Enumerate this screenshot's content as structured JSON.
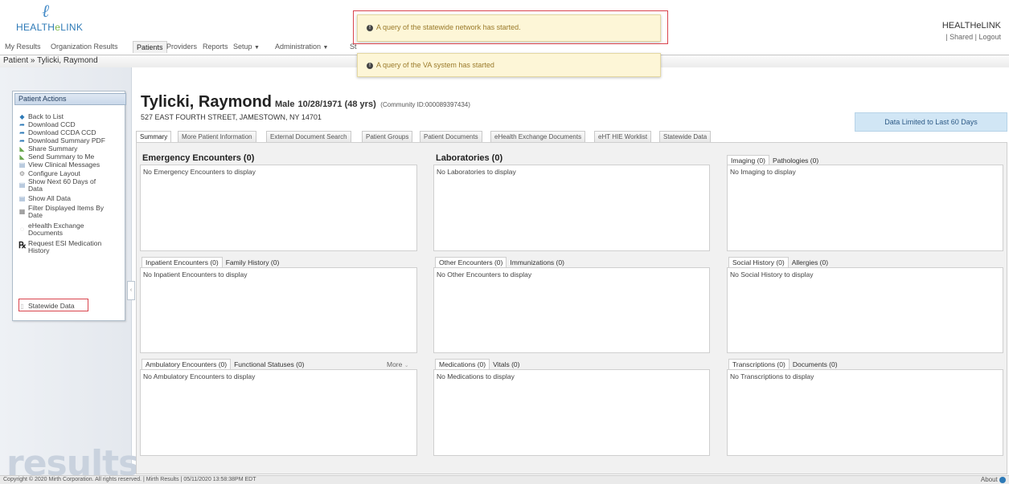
{
  "header": {
    "logo_text_a": "HEALTH",
    "logo_text_e": "e",
    "logo_text_b": "LINK",
    "org_name": "HEALTHeLINK",
    "shared_link": "| Shared",
    "logout_link": "| Logout"
  },
  "nav": {
    "my_results": "My Results",
    "organization_results": "Organization Results",
    "patients": "Patients",
    "providers": "Providers",
    "reports": "Reports",
    "setup": "Setup",
    "administration": "Administration",
    "st": "St"
  },
  "breadcrumb": "Patient » Tylicki, Raymond",
  "toasts": {
    "statewide": "A query of the statewide network has started.",
    "va": "A query of the VA system has started"
  },
  "sidebar": {
    "title": "Patient Actions",
    "items": [
      {
        "label": "Back to List",
        "icon": "diamond-icon"
      },
      {
        "label": "Download CCD",
        "icon": "arrow-icon"
      },
      {
        "label": "Download CCDA CCD",
        "icon": "arrow-icon"
      },
      {
        "label": "Download Summary PDF",
        "icon": "arrow-icon"
      },
      {
        "label": "Share Summary",
        "icon": "share-icon"
      },
      {
        "label": "Send Summary to Me",
        "icon": "send-icon"
      },
      {
        "label": "View Clinical Messages",
        "icon": "document-icon"
      },
      {
        "label": "Configure Layout",
        "icon": "gear-icon"
      },
      {
        "label": "Show Next 60 Days of Data",
        "icon": "document-icon"
      },
      {
        "label": "Show All Data",
        "icon": "document-icon"
      },
      {
        "label": "Filter Displayed Items By Date",
        "icon": "calendar-icon"
      },
      {
        "label": "eHealth Exchange Documents",
        "icon": "exchange-icon"
      },
      {
        "label": "Request ESI Medication History",
        "icon": "rx-icon"
      },
      {
        "label": "Statewide Data",
        "icon": "page-icon"
      }
    ],
    "watermark": "results"
  },
  "patient": {
    "name": "Tylicki, Raymond",
    "gender": "Male",
    "dob": "10/28/1971 (48 yrs)",
    "community_id": "(Community ID:000089397434)",
    "address": "527 EAST FOURTH STREET, JAMESTOWN, NY 14701"
  },
  "data_limited": "Data Limited to Last 60 Days",
  "tabs": [
    "Summary",
    "More Patient Information",
    "External Document Search",
    "Patient Groups",
    "Patient Documents",
    "eHealth Exchange Documents",
    "eHT HIE Worklist",
    "Statewide Data"
  ],
  "panels": {
    "emergency": {
      "title": "Emergency Encounters (0)",
      "empty": "No Emergency Encounters to display"
    },
    "laboratories": {
      "title": "Laboratories (0)",
      "empty": "No Laboratories to display"
    },
    "imaging": {
      "tab1": "Imaging (0)",
      "tab2": "Pathologies (0)",
      "empty": "No Imaging to display"
    },
    "inpatient": {
      "tab1": "Inpatient Encounters (0)",
      "tab2": "Family History (0)",
      "empty": "No Inpatient Encounters to display"
    },
    "other": {
      "tab1": "Other Encounters (0)",
      "tab2": "Immunizations (0)",
      "empty": "No Other Encounters to display"
    },
    "social": {
      "tab1": "Social History (0)",
      "tab2": "Allergies (0)",
      "empty": "No Social History to display"
    },
    "ambulatory": {
      "tab1": "Ambulatory Encounters (0)",
      "tab2": "Functional Statuses (0)",
      "more": "More",
      "empty": "No Ambulatory Encounters to display"
    },
    "medications": {
      "tab1": "Medications (0)",
      "tab2": "Vitals (0)",
      "empty": "No Medications to display"
    },
    "transcriptions": {
      "tab1": "Transcriptions (0)",
      "tab2": "Documents (0)",
      "empty": "No Transcriptions to display"
    }
  },
  "footer": {
    "copyright": "Copyright © 2020 Mirth Corporation. All rights reserved. | Mirth Results | 05/11/2020 13:58:38PM EDT",
    "about": "About"
  }
}
